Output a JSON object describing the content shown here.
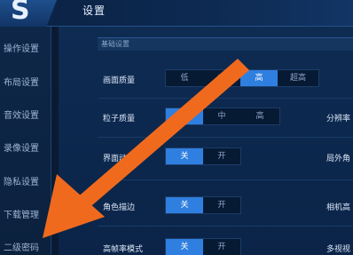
{
  "header": {
    "title": "设置",
    "back_glyph": "S"
  },
  "sidebar": {
    "items": [
      {
        "label": "操作设置"
      },
      {
        "label": "布局设置"
      },
      {
        "label": "音效设置"
      },
      {
        "label": "录像设置"
      },
      {
        "label": "隐私设置"
      },
      {
        "label": "下载管理"
      },
      {
        "label": "二级密码"
      }
    ]
  },
  "section": {
    "title": "基础设置"
  },
  "rows": {
    "quality": {
      "label": "画面质量",
      "options": [
        "低",
        "中",
        "高",
        "超高"
      ],
      "selected": "高"
    },
    "particle": {
      "label": "粒子质量",
      "options": [
        "低",
        "中",
        "高"
      ],
      "selected": "低"
    },
    "ui_anim": {
      "label": "界面动画",
      "options": [
        "关",
        "开"
      ],
      "selected": "关"
    },
    "outline": {
      "label": "角色描边",
      "options": [
        "关",
        "开"
      ],
      "selected": "关"
    },
    "extra": {
      "label": "高帧率模式",
      "options": [
        "关",
        "开"
      ],
      "selected": "关"
    }
  },
  "right_labels": {
    "resolution": "分辨率",
    "angle": "局外角",
    "camera": "相机高",
    "multi": "多视视"
  },
  "colors": {
    "accent": "#2f7fe0",
    "arrow": "#f06a1e"
  },
  "annotation": {
    "arrow_icon": "orange-arrow-icon"
  }
}
